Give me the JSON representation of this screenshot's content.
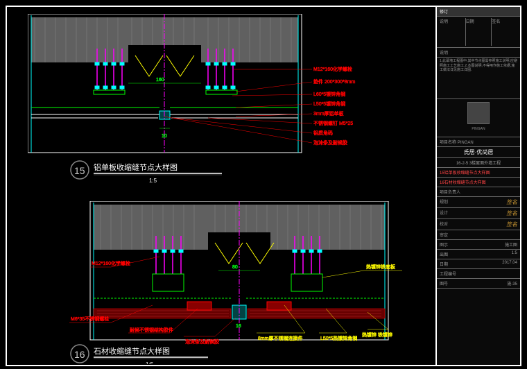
{
  "detail15": {
    "number": "15",
    "title": "铝单板收缩缝节点大样图",
    "scale": "1:5",
    "dim_h": "160",
    "dim_gap": "10",
    "labels": [
      "M12*160化学螺栓",
      "垫件 200*300*8mm",
      "L60*5镀锌角钢",
      "L50*5镀锌角钢",
      "3mm厚铝单板",
      "不锈钢螺钉 M5*25",
      "铝质角码",
      "泡沫条及耐候胶"
    ]
  },
  "detail16": {
    "number": "16",
    "title": "石材收缩缝节点大样图",
    "scale": "1:5",
    "dim_h": "80",
    "dim_gap": "16",
    "labels_left": [
      "M12*160化学螺栓",
      "M6*35不锈钢螺栓",
      "耐候不锈钢结构胶件",
      "泡沫条及耐候胶"
    ],
    "labels_right": [
      "热镀锌铁底板",
      "8mm厚不锈钢连接件",
      "L50*5热镀锌角钢",
      "热镀锌 铁镀锌"
    ]
  },
  "titleblock": {
    "header": "修订",
    "rev_cols": [
      "说明",
      "日期",
      "签名"
    ],
    "note_title": "说明",
    "notes": "1.此幕墙工程图中,其中节点图需参照施工说明,应避照施工工艺施工.2.本图说明,不得用作施工依据,施工做法详见施工详图.",
    "company": "PINGAN",
    "project_label": "项目名称",
    "project": "PINGAN",
    "building": "氏居·优尚居",
    "subproject": "16-2-5 3楼屋面外墙工程",
    "sheet_titles": [
      "15铝单板收缩缝节点大样图",
      "16石材收缩缝节点大样图"
    ],
    "rows": [
      {
        "k": "项目负责人",
        "v": ""
      },
      {
        "k": "规划",
        "v": "sig"
      },
      {
        "k": "设计",
        "v": "sig"
      },
      {
        "k": "校对",
        "v": "sig"
      },
      {
        "k": "审定",
        "v": ""
      },
      {
        "k": "图示",
        "v": "施工图"
      },
      {
        "k": "出图",
        "v": "1:5"
      },
      {
        "k": "日期",
        "v": "2017.04"
      },
      {
        "k": "工程编号",
        "v": ""
      },
      {
        "k": "图号",
        "v": "施-35"
      }
    ]
  }
}
